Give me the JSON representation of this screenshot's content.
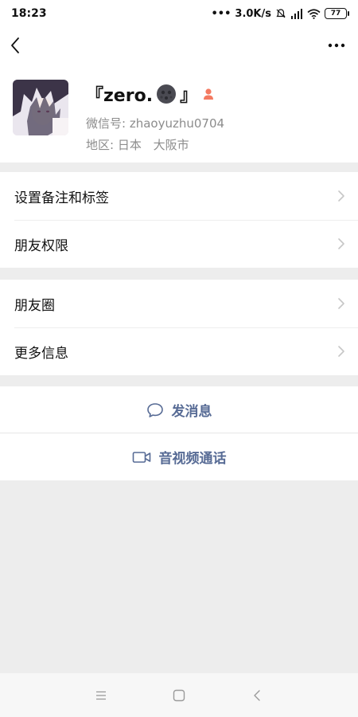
{
  "status": {
    "time": "18:23",
    "network_speed": "3.0K/s",
    "battery": "77"
  },
  "nav": {
    "back_icon": "chevron-left-icon",
    "more_icon": "more-dots-icon"
  },
  "profile": {
    "nickname_prefix": "『zero.",
    "nickname_suffix": "』",
    "wechat_id_label": "微信号:",
    "wechat_id": "zhaoyuzhu0704",
    "region_label": "地区:",
    "region_country": "日本",
    "region_city": "大阪市",
    "moon_icon": "new-moon-face-icon",
    "gender_icon": "female-icon",
    "gender_color": "#f47a61"
  },
  "menu_group_1": [
    {
      "label": "设置备注和标签"
    },
    {
      "label": "朋友权限"
    }
  ],
  "menu_group_2": [
    {
      "label": "朋友圈"
    },
    {
      "label": "更多信息"
    }
  ],
  "actions": {
    "message_label": "发消息",
    "video_call_label": "音视频通话",
    "link_color": "#576b95"
  }
}
